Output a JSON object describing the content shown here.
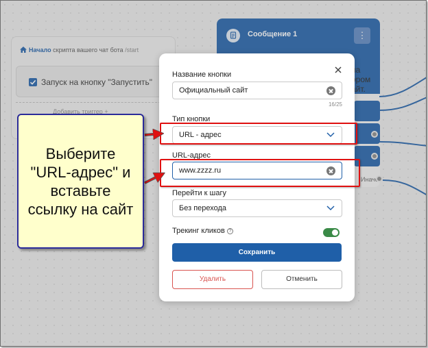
{
  "start_card": {
    "link": "Начало",
    "title": "скрипта вашего чат бота",
    "path": "/start",
    "trigger_label": "Запуск на кнопку \"Запустить\"",
    "add_trigger": "Добавить триггер"
  },
  "message_card": {
    "title": "Сообщение 1",
    "menu_icon": "⋮",
    "text_lines": [
      "на",
      "ором",
      "айт."
    ],
    "footer": "Иначе"
  },
  "note": {
    "text": "Выберите \"URL-адрес\" и вставьте ссылку на сайт"
  },
  "modal": {
    "button_name_label": "Название кнопки",
    "button_name_value": "Официальный сайт",
    "counter": "16/25",
    "button_type_label": "Тип кнопки",
    "button_type_value": "URL - адрес",
    "url_label": "URL-адрес",
    "url_value": "www.zzzz.ru",
    "go_to_step_label": "Перейти к шагу",
    "go_to_step_value": "Без перехода",
    "tracking_label": "Трекинг кликов",
    "tracking_enabled": true,
    "save_label": "Сохранить",
    "delete_label": "Удалить",
    "cancel_label": "Отменить"
  },
  "colors": {
    "primary": "#1f5fa8",
    "danger": "#d9534f",
    "highlight": "#e01010",
    "note_bg": "#ffffcc",
    "note_border": "#2a2a9a",
    "toggle_on": "#3a8a47"
  }
}
